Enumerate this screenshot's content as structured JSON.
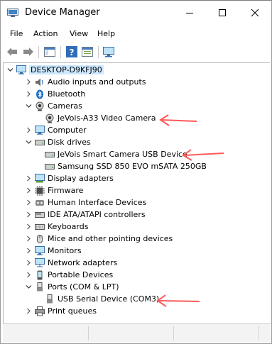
{
  "window": {
    "title": "Device Manager"
  },
  "menu": [
    {
      "label": "File"
    },
    {
      "label": "Action"
    },
    {
      "label": "View"
    },
    {
      "label": "Help"
    }
  ],
  "tree": {
    "root": "DESKTOP-D9KFJ90",
    "nodes": [
      {
        "label": "Audio inputs and outputs",
        "icon": "speaker-icon",
        "expanded": false
      },
      {
        "label": "Bluetooth",
        "icon": "bluetooth-icon",
        "expanded": false
      },
      {
        "label": "Cameras",
        "icon": "camera-icon",
        "expanded": true,
        "children": [
          {
            "label": "JeVois-A33 Video Camera",
            "icon": "camera-icon"
          }
        ]
      },
      {
        "label": "Computer",
        "icon": "monitor-icon",
        "expanded": false
      },
      {
        "label": "Disk drives",
        "icon": "disk-drive-icon",
        "expanded": true,
        "children": [
          {
            "label": "JeVois Smart Camera USB Device",
            "icon": "disk-drive-icon"
          },
          {
            "label": "Samsung SSD 850 EVO mSATA 250GB",
            "icon": "disk-drive-icon"
          }
        ]
      },
      {
        "label": "Display adapters",
        "icon": "display-adapter-icon",
        "expanded": false
      },
      {
        "label": "Firmware",
        "icon": "chip-icon",
        "expanded": false
      },
      {
        "label": "Human Interface Devices",
        "icon": "hid-icon",
        "expanded": false
      },
      {
        "label": "IDE ATA/ATAPI controllers",
        "icon": "ide-controller-icon",
        "expanded": false
      },
      {
        "label": "Keyboards",
        "icon": "keyboard-icon",
        "expanded": false
      },
      {
        "label": "Mice and other pointing devices",
        "icon": "mouse-icon",
        "expanded": false
      },
      {
        "label": "Monitors",
        "icon": "monitor-icon",
        "expanded": false
      },
      {
        "label": "Network adapters",
        "icon": "network-icon",
        "expanded": false
      },
      {
        "label": "Portable Devices",
        "icon": "portable-device-icon",
        "expanded": false
      },
      {
        "label": "Ports (COM & LPT)",
        "icon": "port-icon",
        "expanded": true,
        "children": [
          {
            "label": "USB Serial Device (COM3)",
            "icon": "port-icon"
          }
        ]
      },
      {
        "label": "Print queues",
        "icon": "printer-icon",
        "expanded": false
      }
    ]
  },
  "colors": {
    "selection": "#cde8ff",
    "annotation": "#ff5a5a",
    "accent": "#0078d7"
  }
}
